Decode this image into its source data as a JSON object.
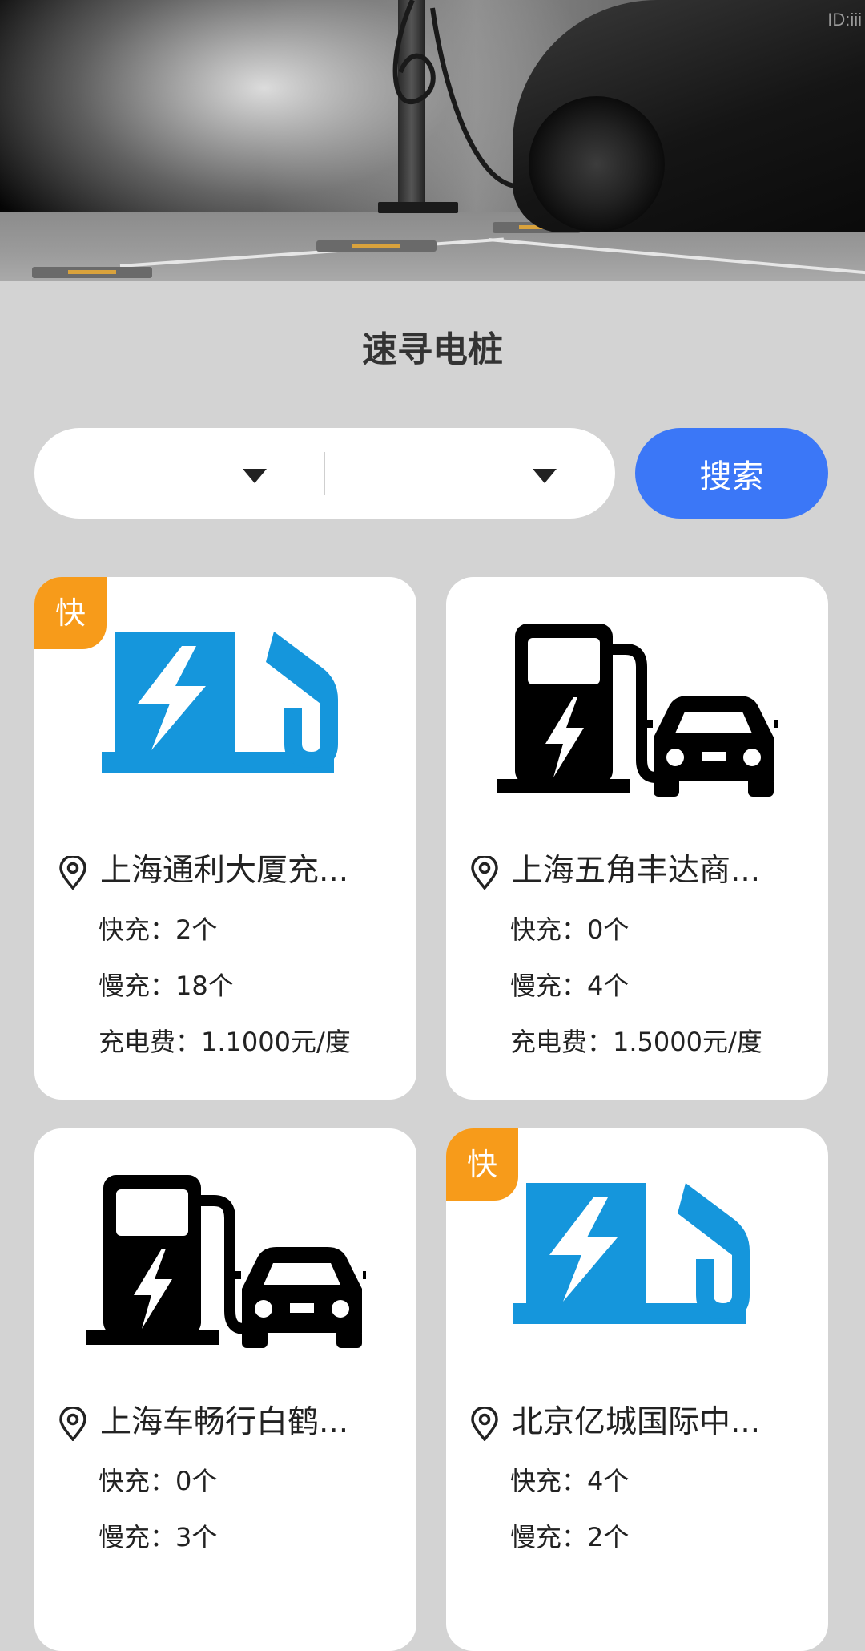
{
  "watermark": "ID:iii",
  "page_title": "速寻电桩",
  "search": {
    "dropdown_1_value": "",
    "dropdown_2_value": "",
    "button_label": "搜索"
  },
  "stations": [
    {
      "name": "上海通利大厦充...",
      "fast_badge": "快",
      "fast": "快充：2个",
      "slow": "慢充：18个",
      "fee": "充电费：1.1000元/度",
      "icon": "blue-charger-icon"
    },
    {
      "name": "上海五角丰达商...",
      "fast_badge": "",
      "fast": "快充：0个",
      "slow": "慢充：4个",
      "fee": "充电费：1.5000元/度",
      "icon": "charging-station-car-icon"
    },
    {
      "name": "上海车畅行白鹤...",
      "fast_badge": "",
      "fast": "快充：0个",
      "slow": "慢充：3个",
      "fee": "",
      "icon": "charging-station-car-icon"
    },
    {
      "name": "北京亿城国际中...",
      "fast_badge": "快",
      "fast": "快充：4个",
      "slow": "慢充：2个",
      "fee": "",
      "icon": "blue-charger-icon"
    }
  ],
  "colors": {
    "accent_blue": "#3b77f7",
    "badge_orange": "#f79b1a",
    "icon_blue": "#1596dc",
    "background": "#d3d3d3"
  }
}
